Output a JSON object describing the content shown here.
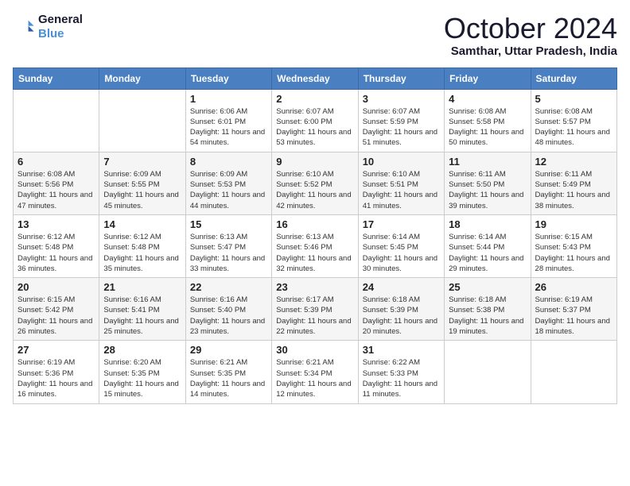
{
  "header": {
    "logo_line1": "General",
    "logo_line2": "Blue",
    "month_title": "October 2024",
    "location": "Samthar, Uttar Pradesh, India"
  },
  "days_of_week": [
    "Sunday",
    "Monday",
    "Tuesday",
    "Wednesday",
    "Thursday",
    "Friday",
    "Saturday"
  ],
  "weeks": [
    [
      {
        "day": "",
        "info": ""
      },
      {
        "day": "",
        "info": ""
      },
      {
        "day": "1",
        "info": "Sunrise: 6:06 AM\nSunset: 6:01 PM\nDaylight: 11 hours and 54 minutes."
      },
      {
        "day": "2",
        "info": "Sunrise: 6:07 AM\nSunset: 6:00 PM\nDaylight: 11 hours and 53 minutes."
      },
      {
        "day": "3",
        "info": "Sunrise: 6:07 AM\nSunset: 5:59 PM\nDaylight: 11 hours and 51 minutes."
      },
      {
        "day": "4",
        "info": "Sunrise: 6:08 AM\nSunset: 5:58 PM\nDaylight: 11 hours and 50 minutes."
      },
      {
        "day": "5",
        "info": "Sunrise: 6:08 AM\nSunset: 5:57 PM\nDaylight: 11 hours and 48 minutes."
      }
    ],
    [
      {
        "day": "6",
        "info": "Sunrise: 6:08 AM\nSunset: 5:56 PM\nDaylight: 11 hours and 47 minutes."
      },
      {
        "day": "7",
        "info": "Sunrise: 6:09 AM\nSunset: 5:55 PM\nDaylight: 11 hours and 45 minutes."
      },
      {
        "day": "8",
        "info": "Sunrise: 6:09 AM\nSunset: 5:53 PM\nDaylight: 11 hours and 44 minutes."
      },
      {
        "day": "9",
        "info": "Sunrise: 6:10 AM\nSunset: 5:52 PM\nDaylight: 11 hours and 42 minutes."
      },
      {
        "day": "10",
        "info": "Sunrise: 6:10 AM\nSunset: 5:51 PM\nDaylight: 11 hours and 41 minutes."
      },
      {
        "day": "11",
        "info": "Sunrise: 6:11 AM\nSunset: 5:50 PM\nDaylight: 11 hours and 39 minutes."
      },
      {
        "day": "12",
        "info": "Sunrise: 6:11 AM\nSunset: 5:49 PM\nDaylight: 11 hours and 38 minutes."
      }
    ],
    [
      {
        "day": "13",
        "info": "Sunrise: 6:12 AM\nSunset: 5:48 PM\nDaylight: 11 hours and 36 minutes."
      },
      {
        "day": "14",
        "info": "Sunrise: 6:12 AM\nSunset: 5:48 PM\nDaylight: 11 hours and 35 minutes."
      },
      {
        "day": "15",
        "info": "Sunrise: 6:13 AM\nSunset: 5:47 PM\nDaylight: 11 hours and 33 minutes."
      },
      {
        "day": "16",
        "info": "Sunrise: 6:13 AM\nSunset: 5:46 PM\nDaylight: 11 hours and 32 minutes."
      },
      {
        "day": "17",
        "info": "Sunrise: 6:14 AM\nSunset: 5:45 PM\nDaylight: 11 hours and 30 minutes."
      },
      {
        "day": "18",
        "info": "Sunrise: 6:14 AM\nSunset: 5:44 PM\nDaylight: 11 hours and 29 minutes."
      },
      {
        "day": "19",
        "info": "Sunrise: 6:15 AM\nSunset: 5:43 PM\nDaylight: 11 hours and 28 minutes."
      }
    ],
    [
      {
        "day": "20",
        "info": "Sunrise: 6:15 AM\nSunset: 5:42 PM\nDaylight: 11 hours and 26 minutes."
      },
      {
        "day": "21",
        "info": "Sunrise: 6:16 AM\nSunset: 5:41 PM\nDaylight: 11 hours and 25 minutes."
      },
      {
        "day": "22",
        "info": "Sunrise: 6:16 AM\nSunset: 5:40 PM\nDaylight: 11 hours and 23 minutes."
      },
      {
        "day": "23",
        "info": "Sunrise: 6:17 AM\nSunset: 5:39 PM\nDaylight: 11 hours and 22 minutes."
      },
      {
        "day": "24",
        "info": "Sunrise: 6:18 AM\nSunset: 5:39 PM\nDaylight: 11 hours and 20 minutes."
      },
      {
        "day": "25",
        "info": "Sunrise: 6:18 AM\nSunset: 5:38 PM\nDaylight: 11 hours and 19 minutes."
      },
      {
        "day": "26",
        "info": "Sunrise: 6:19 AM\nSunset: 5:37 PM\nDaylight: 11 hours and 18 minutes."
      }
    ],
    [
      {
        "day": "27",
        "info": "Sunrise: 6:19 AM\nSunset: 5:36 PM\nDaylight: 11 hours and 16 minutes."
      },
      {
        "day": "28",
        "info": "Sunrise: 6:20 AM\nSunset: 5:35 PM\nDaylight: 11 hours and 15 minutes."
      },
      {
        "day": "29",
        "info": "Sunrise: 6:21 AM\nSunset: 5:35 PM\nDaylight: 11 hours and 14 minutes."
      },
      {
        "day": "30",
        "info": "Sunrise: 6:21 AM\nSunset: 5:34 PM\nDaylight: 11 hours and 12 minutes."
      },
      {
        "day": "31",
        "info": "Sunrise: 6:22 AM\nSunset: 5:33 PM\nDaylight: 11 hours and 11 minutes."
      },
      {
        "day": "",
        "info": ""
      },
      {
        "day": "",
        "info": ""
      }
    ]
  ]
}
